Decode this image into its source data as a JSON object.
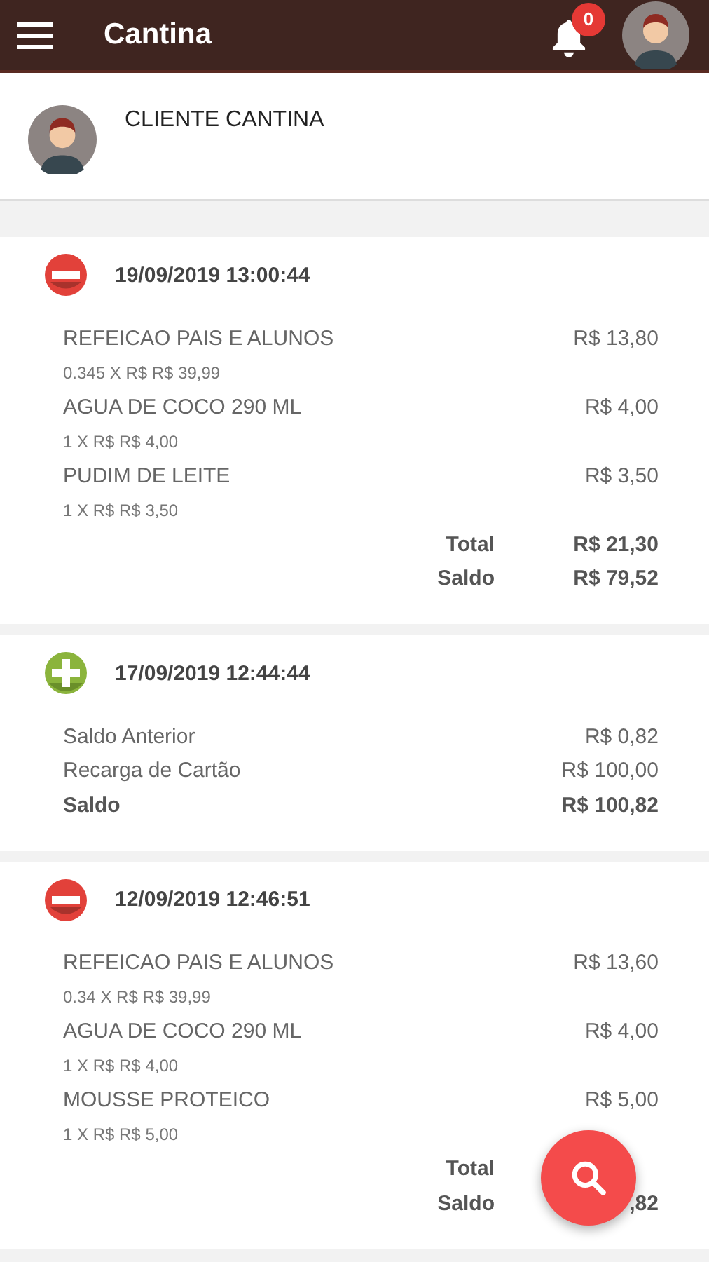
{
  "app_bar": {
    "title": "Cantina",
    "notifications": "0"
  },
  "profile": {
    "name": "CLIENTE CANTINA"
  },
  "transactions": [
    {
      "kind": "debit",
      "date": "19/09/2019 13:00:44",
      "rows": [
        {
          "kind": "item",
          "label": "REFEICAO PAIS E ALUNOS",
          "value": "R$ 13,80",
          "detail": "0.345 X R$ R$ 39,99"
        },
        {
          "kind": "item",
          "label": "AGUA DE COCO 290 ML",
          "value": "R$ 4,00",
          "detail": "1 X R$ R$ 4,00"
        },
        {
          "kind": "item",
          "label": "PUDIM DE LEITE",
          "value": "R$ 3,50",
          "detail": "1 X R$ R$ 3,50"
        },
        {
          "kind": "summary",
          "label": "Total",
          "value": "R$ 21,30"
        },
        {
          "kind": "summary",
          "label": "Saldo",
          "value": "R$ 79,52"
        }
      ]
    },
    {
      "kind": "credit",
      "date": "17/09/2019 12:44:44",
      "rows": [
        {
          "kind": "line",
          "label": "Saldo Anterior",
          "value": "R$ 0,82"
        },
        {
          "kind": "line",
          "label": "Recarga de Cartão",
          "value": "R$ 100,00"
        },
        {
          "kind": "balance",
          "label": "Saldo",
          "value": "R$ 100,82"
        }
      ]
    },
    {
      "kind": "debit",
      "date": "12/09/2019 12:46:51",
      "rows": [
        {
          "kind": "item",
          "label": "REFEICAO PAIS E ALUNOS",
          "value": "R$ 13,60",
          "detail": "0.34 X R$ R$ 39,99"
        },
        {
          "kind": "item",
          "label": "AGUA DE COCO 290 ML",
          "value": "R$ 4,00",
          "detail": "1 X R$ R$ 4,00"
        },
        {
          "kind": "item",
          "label": "MOUSSE PROTEICO",
          "value": "R$ 5,00",
          "detail": "1 X R$ R$ 5,00"
        },
        {
          "kind": "summary",
          "label": "Total"
        },
        {
          "kind": "summary",
          "label": "Saldo",
          "value": ",82"
        }
      ]
    }
  ]
}
